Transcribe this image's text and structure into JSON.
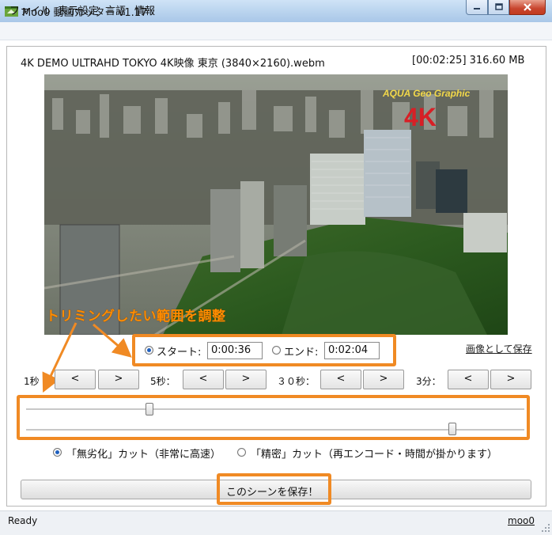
{
  "window": {
    "title": "Moo0 動画カッター v1.17"
  },
  "menu": {
    "items": [
      "ファイル",
      "表示設定",
      "言語",
      "情報"
    ]
  },
  "file": {
    "name": "4K DEMO ULTRAHD TOKYO 4K映像 東京 (3840×2160).webm",
    "info": "[00:02:25]  316.60 MB"
  },
  "video": {
    "watermark_text": "AQUA Geo Graphic",
    "watermark_4k": "4K"
  },
  "annotation": {
    "text": "トリミングしたい範囲を調整"
  },
  "range": {
    "start_label": "スタート:",
    "start_value": "0:00:36",
    "start_selected": true,
    "end_label": "エンド:",
    "end_value": "0:02:04",
    "end_selected": false
  },
  "save_as_image": "画像として保存",
  "steps": [
    {
      "label": "1秒",
      "back": "<",
      "fwd": ">"
    },
    {
      "label": "5秒：",
      "back": "<",
      "fwd": ">"
    },
    {
      "label": "３０秒：",
      "back": "<",
      "fwd": ">"
    },
    {
      "label": "3分：",
      "back": "<",
      "fwd": ">"
    }
  ],
  "slider": {
    "start_fraction": 0.248,
    "end_fraction": 0.855
  },
  "cut_mode": {
    "lossless_label": "「無劣化」カット（非常に高速）",
    "lossless_selected": true,
    "precise_label": "「精密」カット（再エンコード・時間が掛かります）",
    "precise_selected": false
  },
  "save_button": "このシーンを保存！",
  "status": {
    "text": "Ready",
    "link": "moo0"
  },
  "colors": {
    "annotation_orange": "#f08a24",
    "title_bar": "#b9d3ee"
  }
}
